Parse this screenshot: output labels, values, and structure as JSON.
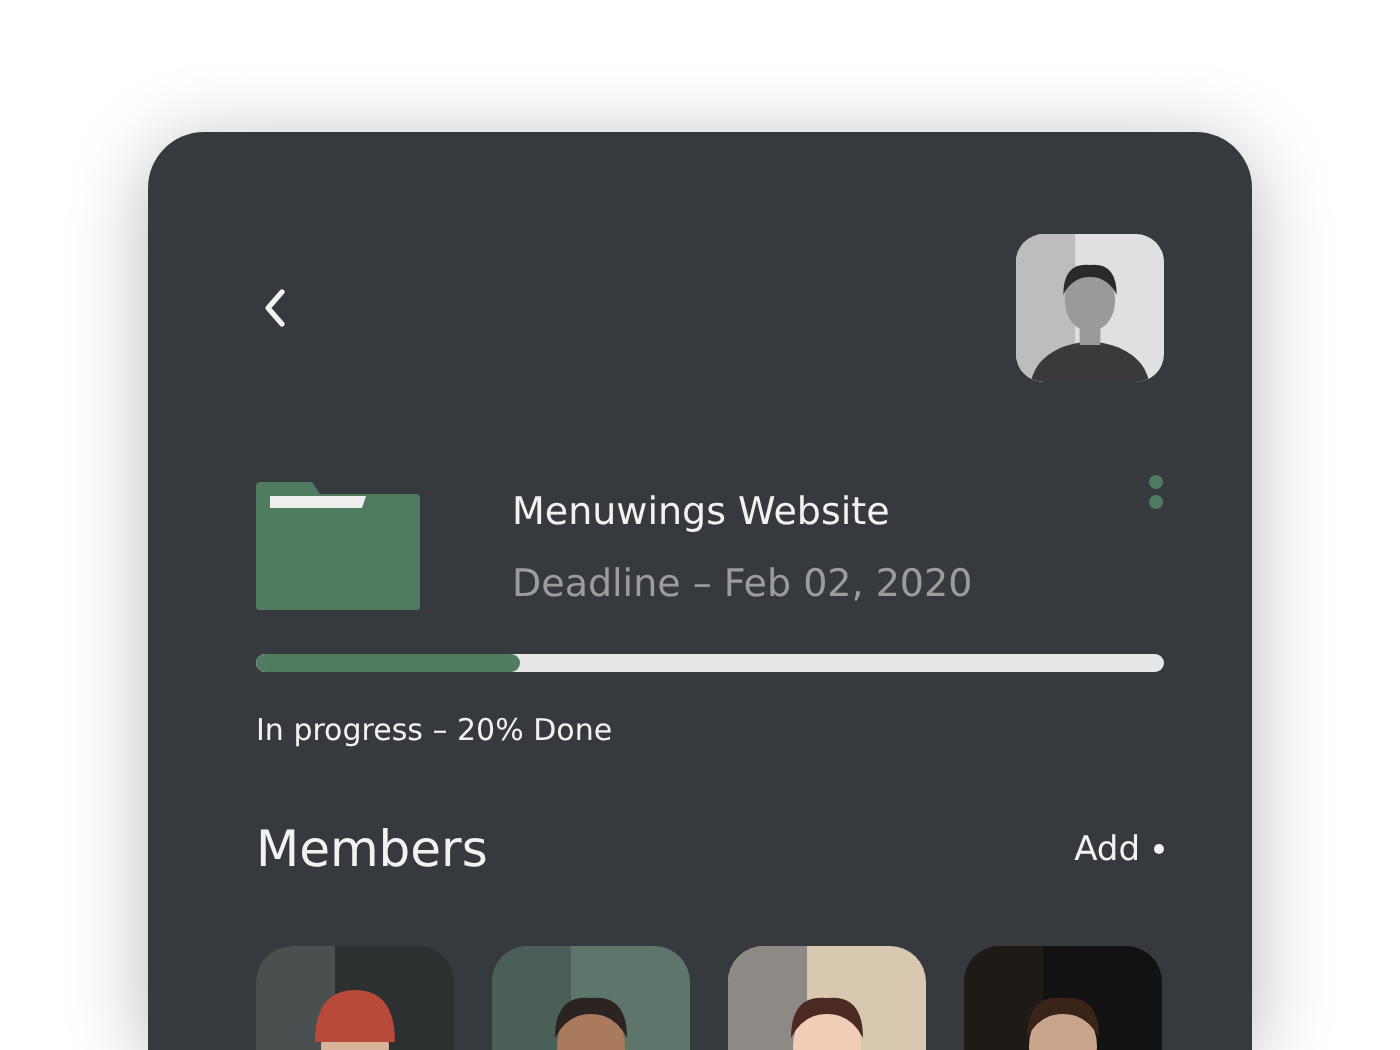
{
  "project": {
    "title": "Menuwings Website",
    "deadline": "Deadline – Feb 02, 2020",
    "progress": {
      "level": 0.29
    },
    "status": "In progress – 20% Done"
  },
  "members": {
    "title": "Members",
    "add_label": "Add"
  }
}
